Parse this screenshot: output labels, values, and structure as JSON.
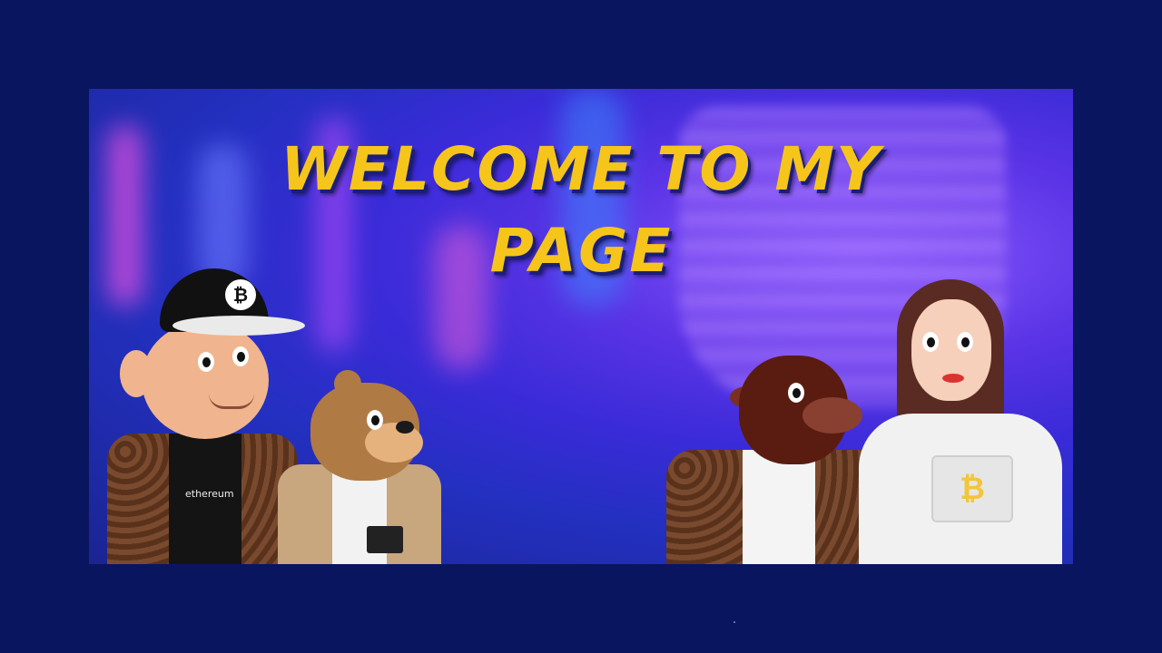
{
  "banner": {
    "headline": "Welcome to my page",
    "characters": [
      {
        "name": "monkey",
        "shirt_text": "ethereum",
        "cap_symbol": "₿"
      },
      {
        "name": "bear"
      },
      {
        "name": "bull"
      },
      {
        "name": "girl",
        "badge_symbol": "₿"
      }
    ]
  },
  "colors": {
    "background": "#0a155f",
    "headline": "#f6c51b"
  }
}
